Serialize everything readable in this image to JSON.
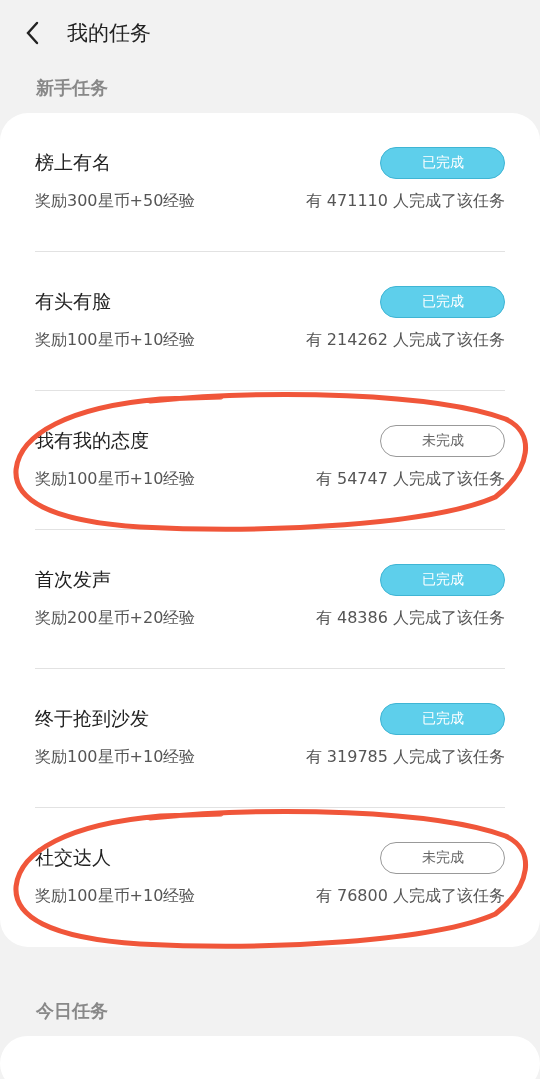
{
  "header": {
    "title": "我的任务"
  },
  "sections": [
    {
      "title": "新手任务",
      "tasks": [
        {
          "name": "榜上有名",
          "reward": "奖励300星币+50经验",
          "count": "有 471110 人完成了该任务",
          "status": "已完成",
          "done": true,
          "circled": false
        },
        {
          "name": "有头有脸",
          "reward": "奖励100星币+10经验",
          "count": "有 214262 人完成了该任务",
          "status": "已完成",
          "done": true,
          "circled": false
        },
        {
          "name": "我有我的态度",
          "reward": "奖励100星币+10经验",
          "count": "有 54747 人完成了该任务",
          "status": "未完成",
          "done": false,
          "circled": true
        },
        {
          "name": "首次发声",
          "reward": "奖励200星币+20经验",
          "count": "有 48386 人完成了该任务",
          "status": "已完成",
          "done": true,
          "circled": false
        },
        {
          "name": "终于抢到沙发",
          "reward": "奖励100星币+10经验",
          "count": "有 319785 人完成了该任务",
          "status": "已完成",
          "done": true,
          "circled": false
        },
        {
          "name": "社交达人",
          "reward": "奖励100星币+10经验",
          "count": "有 76800 人完成了该任务",
          "status": "未完成",
          "done": false,
          "circled": true
        }
      ]
    },
    {
      "title": "今日任务"
    }
  ]
}
